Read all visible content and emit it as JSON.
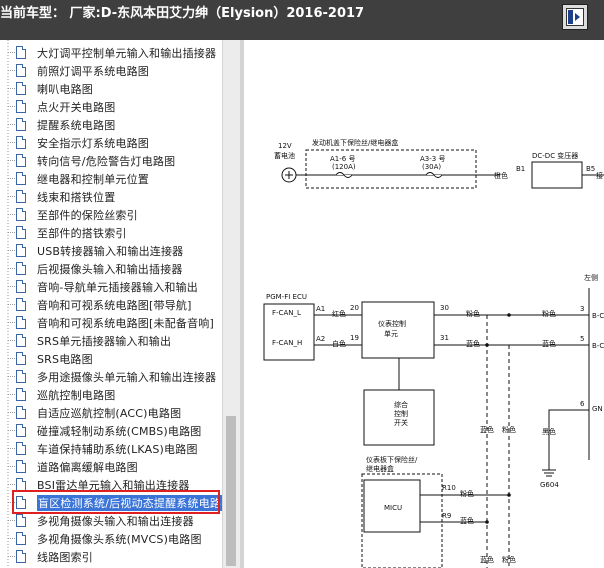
{
  "header": {
    "title": "当前车型：  厂家:D-东风本田艾力绅（Elysion）2016-2017",
    "toggle_icon": "panel-toggle-icon"
  },
  "sidebar": {
    "items": [
      {
        "label": "大灯调平控制单元输入和输出插接器"
      },
      {
        "label": "前照灯调平系统电路图"
      },
      {
        "label": "喇叭电路图"
      },
      {
        "label": "点火开关电路图"
      },
      {
        "label": "提醒系统电路图"
      },
      {
        "label": "安全指示灯系统电路图"
      },
      {
        "label": "转向信号/危险警告灯电路图"
      },
      {
        "label": "继电器和控制单元位置"
      },
      {
        "label": "线束和搭铁位置"
      },
      {
        "label": "至部件的保险丝索引"
      },
      {
        "label": "至部件的搭铁索引"
      },
      {
        "label": "USB转接器输入和输出连接器"
      },
      {
        "label": "后视摄像头输入和输出插接器"
      },
      {
        "label": "音响-导航单元插接器输入和输出"
      },
      {
        "label": "音响和可视系统电路图[带导航]"
      },
      {
        "label": "音响和可视系统电路图[未配备音响]"
      },
      {
        "label": "SRS单元插接器输入和输出"
      },
      {
        "label": "SRS电路图"
      },
      {
        "label": "多用途摄像头单元输入和输出连接器"
      },
      {
        "label": "巡航控制电路图"
      },
      {
        "label": "自适应巡航控制(ACC)电路图"
      },
      {
        "label": "碰撞减轻制动系统(CMBS)电路图"
      },
      {
        "label": "车道保持辅助系统(LKAS)电路图"
      },
      {
        "label": "道路偏离缓解电路图"
      },
      {
        "label": "BSI雷达单元输入和输出连接器"
      },
      {
        "label": "盲区检测系统/后视动态提醒系统电路"
      },
      {
        "label": "多视角摄像头输入和输出连接器"
      },
      {
        "label": "多视角摄像头系统(MVCS)电路图"
      },
      {
        "label": "线路图索引"
      }
    ],
    "selected_index": 25
  },
  "diagram": {
    "battery_label_1": "12V",
    "battery_label_2": "蓄电池",
    "fusebox_title": "发动机盖下保险丝/继电器盒",
    "fuse1_label": "A1-6 号",
    "fuse1_amp": "(120A)",
    "fuse2_label": "A3-3 号",
    "fuse2_amp": "(30A)",
    "wire_color_orange": "橙色",
    "pin_b1": "B1",
    "pin_b5": "B5",
    "dcdc_label": "DC-DC 变压器",
    "right_clip_1": "接",
    "right_clip_2": "左侧",
    "ecu_label": "PGM-FI ECU",
    "fcan_l": "F-CAN_L",
    "fcan_h": "F-CAN_H",
    "pin_a1": "A1",
    "pin_a2": "A2",
    "wire_red": "红色",
    "wire_white": "白色",
    "pin_20": "20",
    "pin_19": "19",
    "meter_label_1": "仪表控制",
    "meter_label_2": "单元",
    "pin_30": "30",
    "pin_31": "31",
    "wire_pink": "粉色",
    "wire_blue": "蓝色",
    "pin_3": "3",
    "pin_5": "5",
    "pin_6": "6",
    "bc_1": "B-C",
    "bc_2": "B-C",
    "gn": "GN",
    "combo_1": "综合",
    "combo_2": "控制",
    "combo_3": "开关",
    "wire_black": "黑色",
    "ground_label": "G604",
    "dash_fuse_1": "仪表板下保险丝/",
    "dash_fuse_2": "继电器盒",
    "micu_label": "MICU",
    "pin_r10": "R10",
    "pin_r9": "R9"
  }
}
